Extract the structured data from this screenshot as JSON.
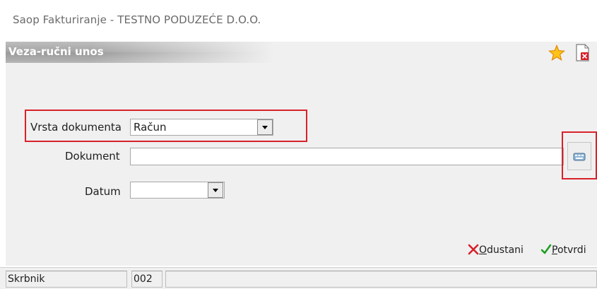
{
  "window": {
    "title": "Saop Fakturiranje - TESTNO PODUZEĆE D.O.O."
  },
  "header": {
    "title": "Veza-ručni unos",
    "icons": [
      "star-icon",
      "delete-document-icon"
    ]
  },
  "form": {
    "document_type": {
      "label": "Vrsta dokumenta",
      "value": "Račun"
    },
    "document": {
      "label": "Dokument",
      "value": ""
    },
    "date": {
      "label": "Datum",
      "value": ""
    }
  },
  "actions": {
    "cancel": {
      "underlined": "O",
      "rest": "dustani",
      "icon": "red-x-icon"
    },
    "confirm": {
      "underlined": "P",
      "rest": "otvrdi",
      "icon": "green-check-icon"
    }
  },
  "status": {
    "label": "Skrbnik",
    "code": "002"
  },
  "colors": {
    "highlight": "#d8212a",
    "header_gradient": "#a5a5a5",
    "panel": "#f0f0f0"
  }
}
